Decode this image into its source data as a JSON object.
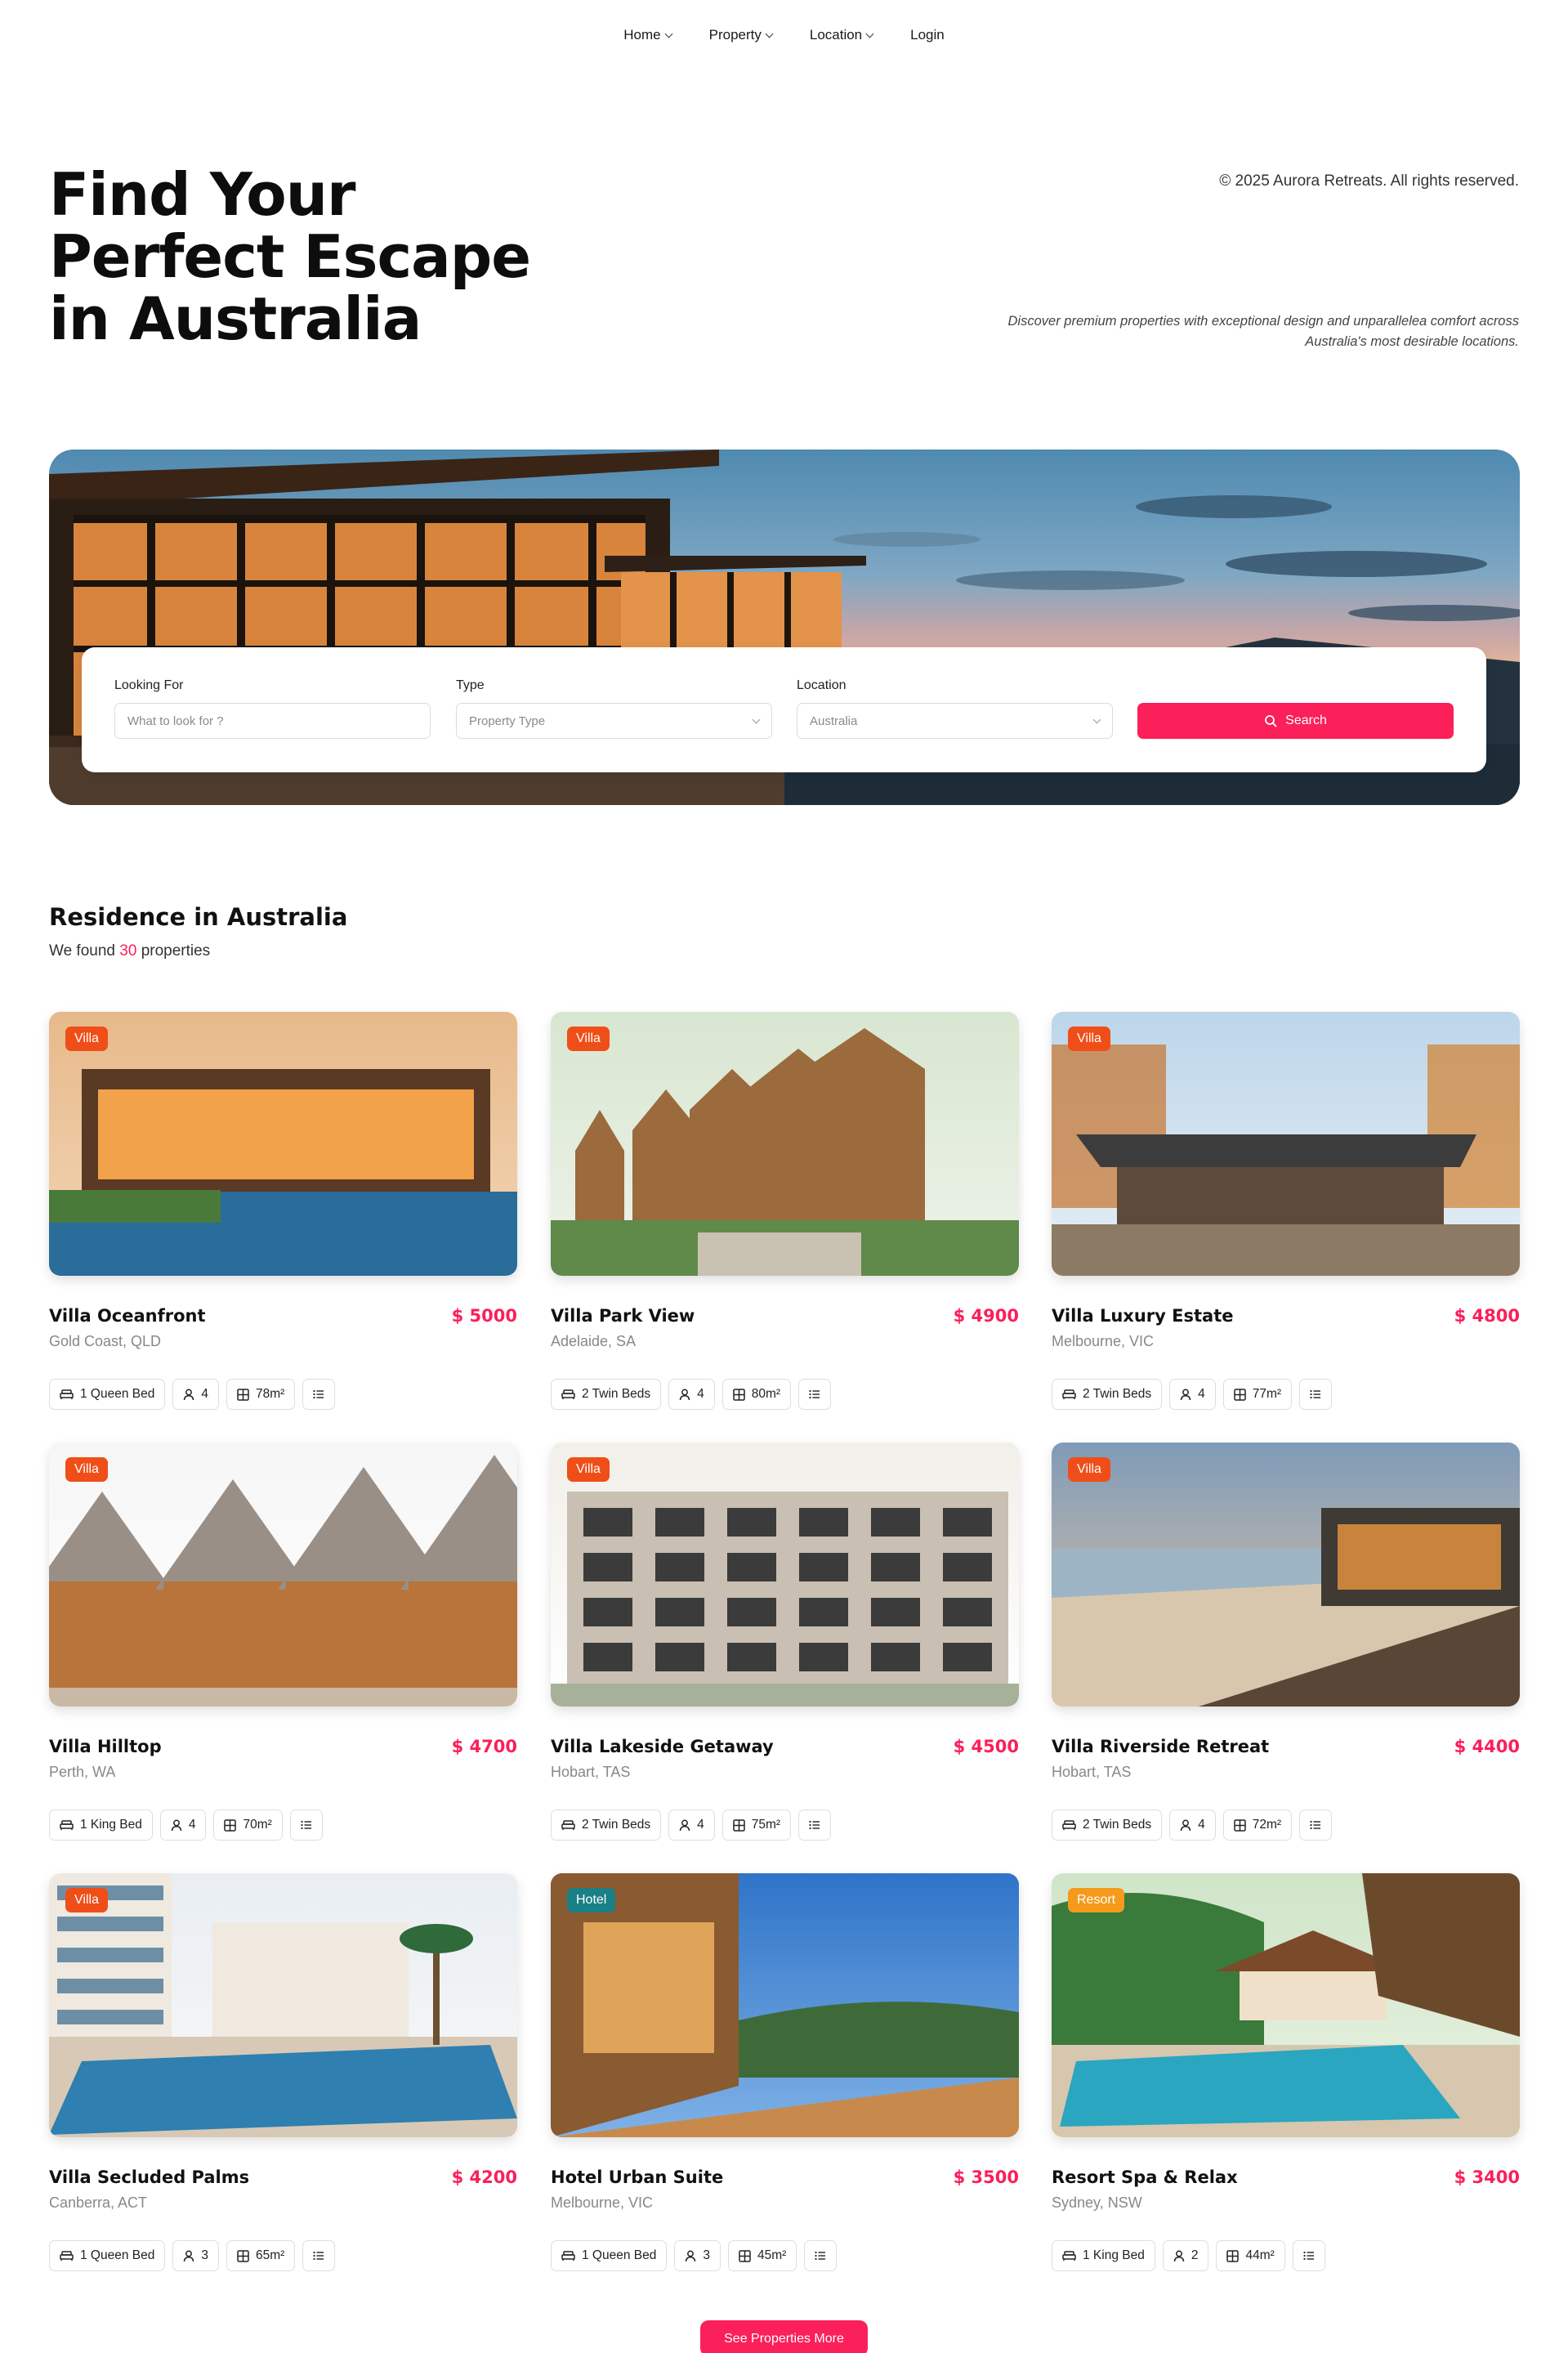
{
  "nav": {
    "items": [
      {
        "label": "Home",
        "has_dropdown": true
      },
      {
        "label": "Property",
        "has_dropdown": true
      },
      {
        "label": "Location",
        "has_dropdown": true
      },
      {
        "label": "Login",
        "has_dropdown": false
      }
    ]
  },
  "hero": {
    "title": "Find Your\nPerfect Escape\nin Australia",
    "copyright": "© 2025 Aurora Retreats. All rights reserved.",
    "description": "Discover premium properties with exceptional design and unparallelea comfort across Australia's most desirable locations."
  },
  "search": {
    "looking_for": {
      "label": "Looking For",
      "placeholder": "What to look for ?"
    },
    "type": {
      "label": "Type",
      "value": "Property Type"
    },
    "location": {
      "label": "Location",
      "value": "Australia"
    },
    "button_label": "Search"
  },
  "listing": {
    "title": "Residence in Australia",
    "found_prefix": "We found",
    "count": "30",
    "found_suffix": "properties"
  },
  "colors": {
    "accent": "#fb1f5a",
    "badge_villa": "#f04e18",
    "badge_hotel": "#1a7f86",
    "badge_resort": "#f59a1b"
  },
  "properties": [
    {
      "badge": "Villa",
      "name": "Villa Oceanfront",
      "price": "$ 5000",
      "location": "Gold Coast, QLD",
      "bed": "1 Queen Bed",
      "guests": "4",
      "area": "78m²"
    },
    {
      "badge": "Villa",
      "name": "Villa Park View",
      "price": "$ 4900",
      "location": "Adelaide, SA",
      "bed": "2 Twin Beds",
      "guests": "4",
      "area": "80m²"
    },
    {
      "badge": "Villa",
      "name": "Villa Luxury Estate",
      "price": "$ 4800",
      "location": "Melbourne, VIC",
      "bed": "2 Twin Beds",
      "guests": "4",
      "area": "77m²"
    },
    {
      "badge": "Villa",
      "name": "Villa Hilltop",
      "price": "$ 4700",
      "location": "Perth, WA",
      "bed": "1 King Bed",
      "guests": "4",
      "area": "70m²"
    },
    {
      "badge": "Villa",
      "name": "Villa Lakeside Getaway",
      "price": "$ 4500",
      "location": "Hobart, TAS",
      "bed": "2 Twin Beds",
      "guests": "4",
      "area": "75m²"
    },
    {
      "badge": "Villa",
      "name": "Villa Riverside Retreat",
      "price": "$ 4400",
      "location": "Hobart, TAS",
      "bed": "2 Twin Beds",
      "guests": "4",
      "area": "72m²"
    },
    {
      "badge": "Villa",
      "name": "Villa Secluded Palms",
      "price": "$ 4200",
      "location": "Canberra, ACT",
      "bed": "1 Queen Bed",
      "guests": "3",
      "area": "65m²"
    },
    {
      "badge": "Hotel",
      "name": "Hotel Urban Suite",
      "price": "$ 3500",
      "location": "Melbourne, VIC",
      "bed": "1 Queen Bed",
      "guests": "3",
      "area": "45m²"
    },
    {
      "badge": "Resort",
      "name": "Resort Spa & Relax",
      "price": "$ 3400",
      "location": "Sydney, NSW",
      "bed": "1 King Bed",
      "guests": "2",
      "area": "44m²"
    }
  ],
  "more_button": "See Properties More"
}
